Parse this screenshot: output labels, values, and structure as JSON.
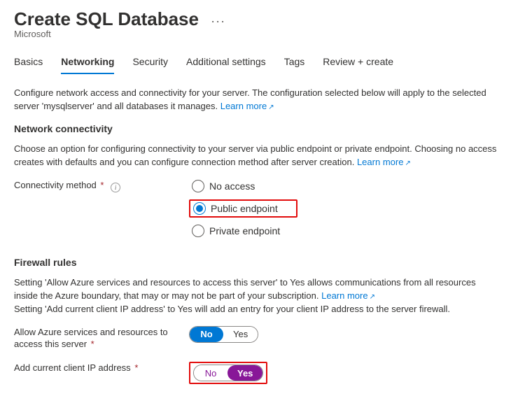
{
  "header": {
    "title": "Create SQL Database",
    "more": "...",
    "subtitle": "Microsoft"
  },
  "tabs": {
    "items": [
      {
        "label": "Basics",
        "active": false
      },
      {
        "label": "Networking",
        "active": true
      },
      {
        "label": "Security",
        "active": false
      },
      {
        "label": "Additional settings",
        "active": false
      },
      {
        "label": "Tags",
        "active": false
      },
      {
        "label": "Review + create",
        "active": false
      }
    ]
  },
  "intro": {
    "text": "Configure network access and connectivity for your server. The configuration selected below will apply to the selected server 'mysqlserver' and all databases it manages. ",
    "learn_more": "Learn more"
  },
  "connectivity": {
    "heading": "Network connectivity",
    "desc": "Choose an option for configuring connectivity to your server via public endpoint or private endpoint. Choosing no access creates with defaults and you can configure connection method after server creation. ",
    "learn_more": "Learn more",
    "field_label": "Connectivity method",
    "options": [
      {
        "label": "No access",
        "selected": false
      },
      {
        "label": "Public endpoint",
        "selected": true
      },
      {
        "label": "Private endpoint",
        "selected": false
      }
    ]
  },
  "firewall": {
    "heading": "Firewall rules",
    "desc_line1_a": "Setting 'Allow Azure services and resources to access this server' to Yes allows communications from all resources inside the Azure boundary, that may or may not be part of your subscription. ",
    "learn_more": "Learn more",
    "desc_line2": "Setting 'Add current client IP address' to Yes will add an entry for your client IP address to the server firewall.",
    "allow_azure": {
      "label_line1": "Allow Azure services and resources to",
      "label_line2": "access this server",
      "no": "No",
      "yes": "Yes",
      "value": "No"
    },
    "add_ip": {
      "label": "Add current client IP address",
      "no": "No",
      "yes": "Yes",
      "value": "Yes"
    }
  }
}
